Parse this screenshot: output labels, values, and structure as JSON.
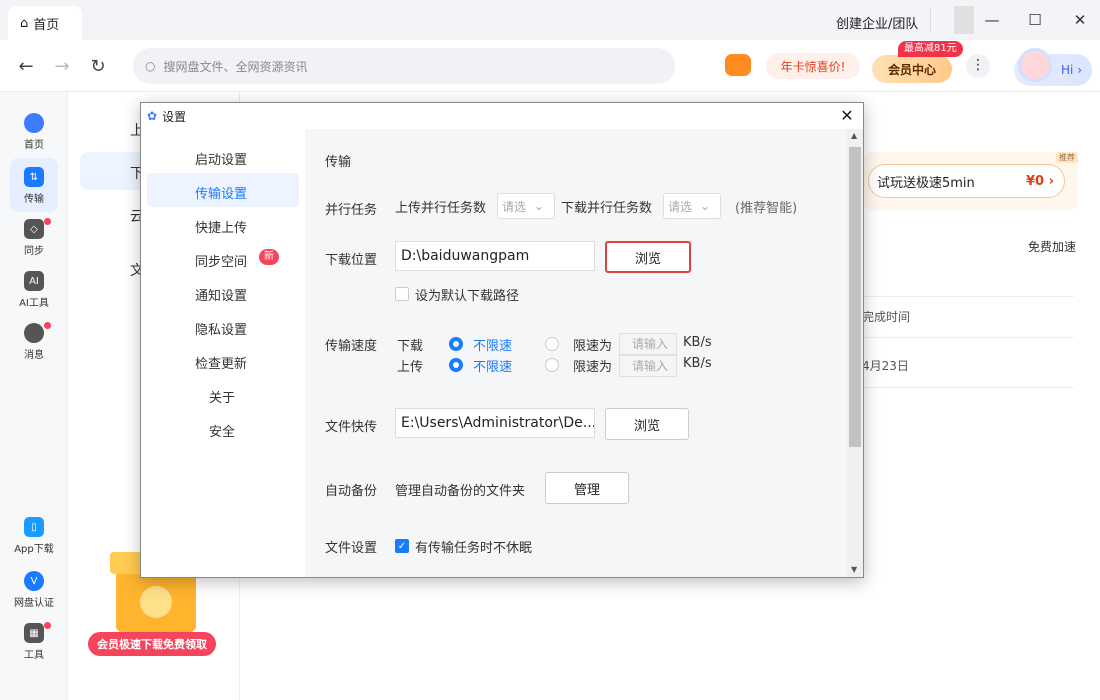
{
  "titlebar": {
    "home_tab": "首页",
    "team_link": "创建企业/团队",
    "minimize": "—",
    "maximize": "☐",
    "close": "✕"
  },
  "navbar": {
    "search_placeholder": "搜网盘文件、全网资源资讯",
    "promo": "年卡惊喜价!",
    "vip_badge": "最高减81元",
    "vip": "会员中心",
    "more": "⋮",
    "hi": "Hi ›"
  },
  "sidebar": {
    "items": [
      {
        "label": "首页",
        "icon": "cloud-icon"
      },
      {
        "label": "传输",
        "icon": "transfer-icon"
      },
      {
        "label": "同步",
        "icon": "sync-icon"
      },
      {
        "label": "AI工具",
        "icon": "ai-icon"
      },
      {
        "label": "消息",
        "icon": "message-icon"
      },
      {
        "label": "App下载",
        "icon": "phone-icon"
      },
      {
        "label": "网盘认证",
        "icon": "verify-icon"
      },
      {
        "label": "工具",
        "icon": "grid-icon"
      }
    ]
  },
  "leftcol": {
    "items": [
      "上",
      "下",
      "云",
      "文"
    ],
    "promo": "会员极速下载免费领取"
  },
  "right": {
    "try_vip": "试玩送极速5min",
    "try_price": "¥0 ›",
    "try_tag": "推荐",
    "accel": "免费加速",
    "col_head": "完成时间",
    "row_date": "4月23日"
  },
  "dialog": {
    "title": "设置",
    "close": "✕",
    "nav": [
      "启动设置",
      "传输设置",
      "快捷上传",
      "同步空间",
      "通知设置",
      "隐私设置",
      "检查更新",
      "关于",
      "安全"
    ],
    "new_badge": "新",
    "section": "传输",
    "parallel": {
      "label": "并行任务",
      "upload": "上传并行任务数",
      "upload_sel": "请选",
      "download": "下载并行任务数",
      "download_sel": "请选",
      "hint": "(推荐智能)"
    },
    "download_loc": {
      "label": "下载位置",
      "path": "D:\\baiduwangpam",
      "browse": "浏览",
      "default_label": "设为默认下载路径"
    },
    "speed": {
      "label": "传输速度",
      "download": "下载",
      "upload": "上传",
      "unlimited": "不限速",
      "limit": "限速为",
      "input_ph": "请输入",
      "unit": "KB/s"
    },
    "quick_send": {
      "label": "文件快传",
      "path": "E:\\Users\\Administrator\\De...",
      "browse": "浏览"
    },
    "backup": {
      "label": "自动备份",
      "desc": "管理自动备份的文件夹",
      "btn": "管理"
    },
    "file": {
      "label": "文件设置",
      "nosleep": "有传输任务时不休眠"
    }
  }
}
